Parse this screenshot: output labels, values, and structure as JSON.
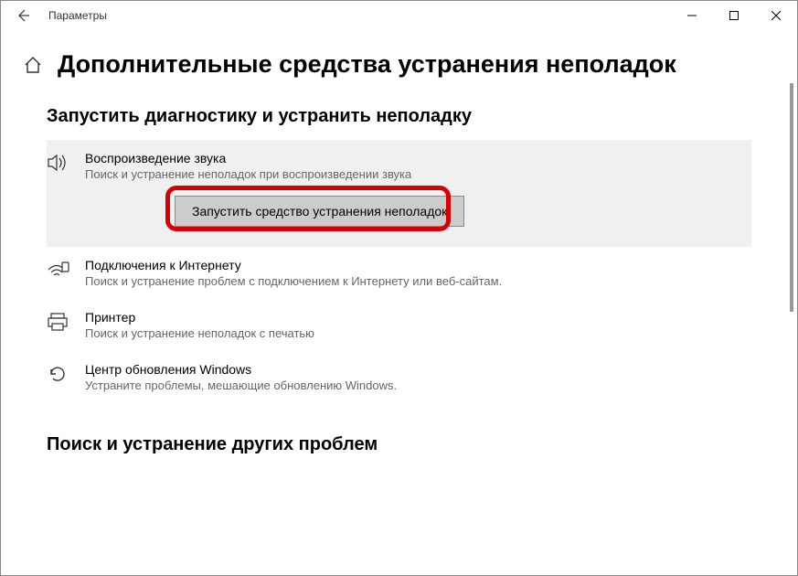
{
  "titlebar": {
    "app_name": "Параметры"
  },
  "header": {
    "page_title": "Дополнительные средства устранения неполадок"
  },
  "section1": {
    "title": "Запустить диагностику и устранить неполадку",
    "items": [
      {
        "title": "Воспроизведение звука",
        "desc": "Поиск и устранение неполадок при воспроизведении звука",
        "run_label": "Запустить средство устранения неполадок"
      },
      {
        "title": "Подключения к Интернету",
        "desc": "Поиск и устранение проблем с подключением к Интернету или веб-сайтам."
      },
      {
        "title": "Принтер",
        "desc": "Поиск и устранение неполадок с печатью"
      },
      {
        "title": "Центр обновления Windows",
        "desc": "Устраните проблемы, мешающие обновлению Windows."
      }
    ]
  },
  "section2": {
    "title": "Поиск и устранение других проблем"
  }
}
